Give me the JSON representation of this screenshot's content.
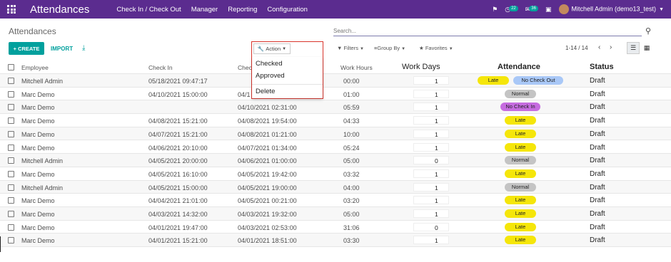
{
  "app": {
    "title": "Attendances",
    "menu": [
      "Check In / Check Out",
      "Manager",
      "Reporting",
      "Configuration"
    ],
    "activity_count": "22",
    "message_count": "36",
    "user": "Mitchell Admin (demo13_test)"
  },
  "control": {
    "breadcrumb": "Attendances",
    "search_placeholder": "Search...",
    "create_label": "CREATE",
    "import_label": "IMPORT",
    "action_label": "Action",
    "action_menu": [
      "Checked",
      "Approved",
      "Delete"
    ],
    "filters_label": "Filters",
    "groupby_label": "Group By",
    "favorites_label": "Favorites",
    "pager": "1-14 / 14"
  },
  "table": {
    "columns": [
      "Employee",
      "Check In",
      "Chec",
      "Work Hours",
      "Work Days",
      "Attendance",
      "Status"
    ],
    "rows": [
      {
        "employee": "Mitchell Admin",
        "check_in": "05/18/2021 09:47:17",
        "check_out": "",
        "work_hours": "00:00",
        "work_days": "1",
        "attendance": [
          "Late",
          "No Check Out"
        ],
        "status": "Draft"
      },
      {
        "employee": "Marc Demo",
        "check_in": "04/10/2021 15:00:00",
        "check_out": "04/1",
        "work_hours": "01:00",
        "work_days": "1",
        "attendance": [
          "Normal"
        ],
        "status": "Draft"
      },
      {
        "employee": "Marc Demo",
        "check_in": "",
        "check_out": "04/10/2021 02:31:00",
        "work_hours": "05:59",
        "work_days": "1",
        "attendance": [
          "No Check In"
        ],
        "status": "Draft"
      },
      {
        "employee": "Marc Demo",
        "check_in": "04/08/2021 15:21:00",
        "check_out": "04/08/2021 19:54:00",
        "work_hours": "04:33",
        "work_days": "1",
        "attendance": [
          "Late"
        ],
        "status": "Draft"
      },
      {
        "employee": "Marc Demo",
        "check_in": "04/07/2021 15:21:00",
        "check_out": "04/08/2021 01:21:00",
        "work_hours": "10:00",
        "work_days": "1",
        "attendance": [
          "Late"
        ],
        "status": "Draft"
      },
      {
        "employee": "Marc Demo",
        "check_in": "04/06/2021 20:10:00",
        "check_out": "04/07/2021 01:34:00",
        "work_hours": "05:24",
        "work_days": "1",
        "attendance": [
          "Late"
        ],
        "status": "Draft"
      },
      {
        "employee": "Mitchell Admin",
        "check_in": "04/05/2021 20:00:00",
        "check_out": "04/06/2021 01:00:00",
        "work_hours": "05:00",
        "work_days": "0",
        "attendance": [
          "Normal"
        ],
        "status": "Draft"
      },
      {
        "employee": "Marc Demo",
        "check_in": "04/05/2021 16:10:00",
        "check_out": "04/05/2021 19:42:00",
        "work_hours": "03:32",
        "work_days": "1",
        "attendance": [
          "Late"
        ],
        "status": "Draft"
      },
      {
        "employee": "Mitchell Admin",
        "check_in": "04/05/2021 15:00:00",
        "check_out": "04/05/2021 19:00:00",
        "work_hours": "04:00",
        "work_days": "1",
        "attendance": [
          "Normal"
        ],
        "status": "Draft"
      },
      {
        "employee": "Marc Demo",
        "check_in": "04/04/2021 21:01:00",
        "check_out": "04/05/2021 00:21:00",
        "work_hours": "03:20",
        "work_days": "1",
        "attendance": [
          "Late"
        ],
        "status": "Draft"
      },
      {
        "employee": "Marc Demo",
        "check_in": "04/03/2021 14:32:00",
        "check_out": "04/03/2021 19:32:00",
        "work_hours": "05:00",
        "work_days": "1",
        "attendance": [
          "Late"
        ],
        "status": "Draft"
      },
      {
        "employee": "Marc Demo",
        "check_in": "04/01/2021 19:47:00",
        "check_out": "04/03/2021 02:53:00",
        "work_hours": "31:06",
        "work_days": "0",
        "attendance": [
          "Late"
        ],
        "status": "Draft"
      },
      {
        "employee": "Marc Demo",
        "check_in": "04/01/2021 15:21:00",
        "check_out": "04/01/2021 18:51:00",
        "work_hours": "03:30",
        "work_days": "1",
        "attendance": [
          "Late"
        ],
        "status": "Draft"
      }
    ]
  },
  "colors": {
    "navbar": "#5b2c8f",
    "primary": "#00a09d",
    "late": "#f5e60a",
    "normal": "#c4c4c4",
    "no_check_out": "#a9c8f7",
    "no_check_in": "#c66ce0"
  }
}
